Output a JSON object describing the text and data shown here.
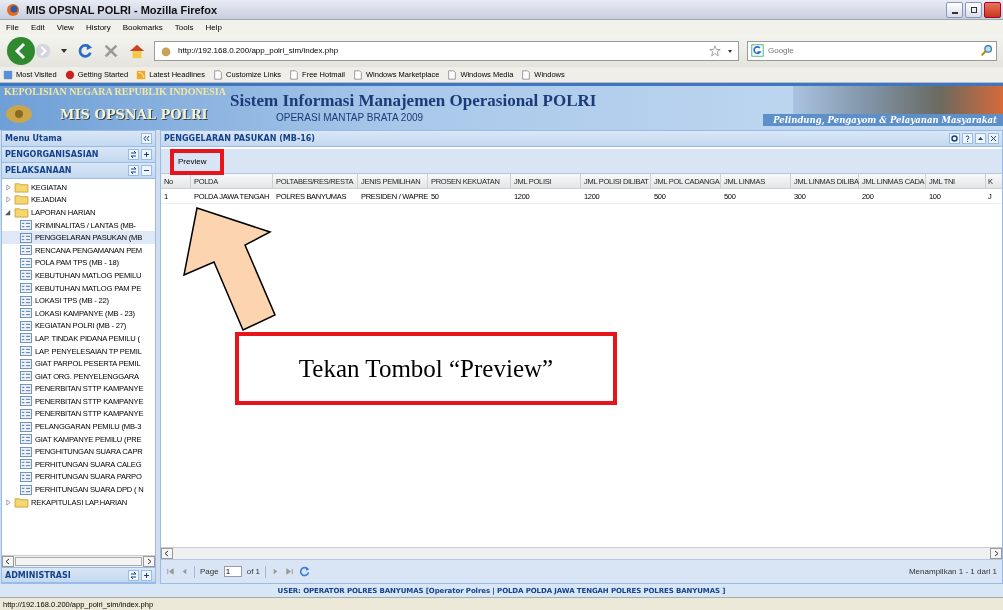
{
  "window": {
    "title": "MIS OPSNAL POLRI - Mozilla Firefox"
  },
  "menu": [
    "File",
    "Edit",
    "View",
    "History",
    "Bookmarks",
    "Tools",
    "Help"
  ],
  "address": {
    "value": "http://192.168.0.200/app_polri_sim/index.php"
  },
  "search": {
    "placeholder": "Google"
  },
  "bookmarks": [
    {
      "label": "Most Visited",
      "kind": "smart"
    },
    {
      "label": "Getting Started",
      "kind": "start"
    },
    {
      "label": "Latest Headlines",
      "kind": "feed"
    },
    {
      "label": "Customize Links",
      "kind": "page"
    },
    {
      "label": "Free Hotmail",
      "kind": "page"
    },
    {
      "label": "Windows Marketplace",
      "kind": "page"
    },
    {
      "label": "Windows Media",
      "kind": "page"
    },
    {
      "label": "Windows",
      "kind": "page"
    }
  ],
  "banner": {
    "agency": "KEPOLISIAN NEGARA REPUBLIK INDONESIA",
    "system": "Sistem Informasi Manajemen Operasional POLRI",
    "app": "MIS OPSNAL POLRI",
    "operation": "OPERASI MANTAP BRATA 2009",
    "motto": "Pelindung, Pengayom & Pelayanan Masyarakat"
  },
  "sidebar": {
    "title": "Menu Utama",
    "sections": [
      {
        "title": "PENGORGANISASIAN",
        "expanded": false
      },
      {
        "title": "PELAKSANAAN",
        "expanded": true,
        "tree": [
          {
            "label": "KEGIATAN",
            "expanded": false
          },
          {
            "label": "KEJADIAN",
            "expanded": false
          },
          {
            "label": "LAPORAN HARIAN",
            "expanded": true,
            "children": [
              {
                "label": "KRIMINALITAS / LANTAS (MB-",
                "selected": false
              },
              {
                "label": "PENGGELARAN PASUKAN (MB",
                "selected": true
              },
              {
                "label": "RENCANA PENGAMANAN PEM",
                "selected": false
              },
              {
                "label": "POLA PAM TPS (MB - 18)",
                "selected": false
              },
              {
                "label": "KEBUTUHAN MATLOG PEMILU",
                "selected": false
              },
              {
                "label": "KEBUTUHAN MATLOG PAM PE",
                "selected": false
              },
              {
                "label": "LOKASI TPS (MB - 22)",
                "selected": false
              },
              {
                "label": "LOKASI KAMPANYE (MB - 23)",
                "selected": false
              },
              {
                "label": "KEGIATAN POLRI (MB - 27)",
                "selected": false
              },
              {
                "label": "LAP. TINDAK PIDANA PEMILU (",
                "selected": false
              },
              {
                "label": "LAP. PENYELESAIAN TP PEMIL",
                "selected": false
              },
              {
                "label": "GIAT PARPOL PESERTA PEMIL",
                "selected": false
              },
              {
                "label": "GIAT ORG. PENYELENGGARA",
                "selected": false
              },
              {
                "label": "PENERBITAN STTP KAMPANYE",
                "selected": false
              },
              {
                "label": "PENERBITAN STTP KAMPANYE",
                "selected": false
              },
              {
                "label": "PENERBITAN STTP KAMPANYE",
                "selected": false
              },
              {
                "label": "PELANGGARAN PEMILU (MB-3",
                "selected": false
              },
              {
                "label": "GIAT KAMPANYE PEMILU (PRE",
                "selected": false
              },
              {
                "label": "PENGHITUNGAN SUARA CAPR",
                "selected": false
              },
              {
                "label": "PERHITUNGAN SUARA CALEG",
                "selected": false
              },
              {
                "label": "PERHITUNGAN SUARA PARPO",
                "selected": false
              },
              {
                "label": "PERHITUNGAN SUARA DPD ( N",
                "selected": false
              }
            ]
          },
          {
            "label": "REKAPITULASI LAP.HARIAN",
            "expanded": false
          }
        ]
      }
    ],
    "bottom_section": {
      "title": "ADMINISTRASI",
      "expanded": false
    }
  },
  "panel": {
    "title": "PENGGELARAN PASUKAN (MB-16)",
    "toolbar": [
      "Preview"
    ],
    "table": {
      "columns": [
        "No",
        "POLDA",
        "POLTABES/RES/RESTA",
        "JENIS PEMILIHAN",
        "PROSEN KEKUATAN",
        "JML POLISI",
        "JML POLISI DILIBAT",
        "JML POL CADANGA",
        "JML LINMAS",
        "JML LINMAS DILIBA",
        "JML LINMAS CADA",
        "JML TNI",
        "K"
      ],
      "rows": [
        [
          "1",
          "POLDA JAWA TENGAH",
          "POLRES BANYUMAS",
          "PRESIDEN / WAPRE",
          "50",
          "1200",
          "1200",
          "500",
          "500",
          "300",
          "200",
          "100",
          "J"
        ]
      ]
    },
    "pager": {
      "page_label": "Page",
      "page": "1",
      "of": "of 1",
      "summary": "Menampilkan 1 - 1 dari 1"
    }
  },
  "user_bar": "USER: OPERATOR POLRES BANYUMAS [Operator Polres | POLDA POLDA JAWA TENGAH POLRES POLRES BANYUMAS ]",
  "status_bar": "http://192.168.0.200/app_polri_sim/index.php",
  "annotation": {
    "text": "Tekan Tombol “Preview”"
  }
}
